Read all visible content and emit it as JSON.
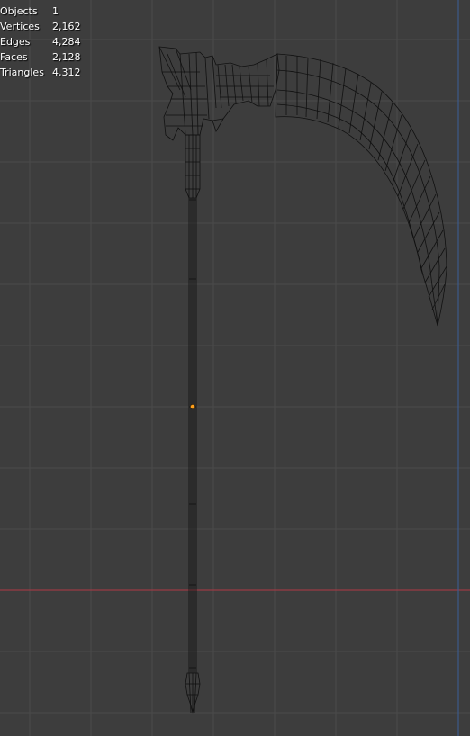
{
  "stats": [
    {
      "label": "Objects",
      "value": "1"
    },
    {
      "label": "Vertices",
      "value": "2,162"
    },
    {
      "label": "Edges",
      "value": "4,284"
    },
    {
      "label": "Faces",
      "value": "2,128"
    },
    {
      "label": "Triangles",
      "value": "4,312"
    }
  ],
  "colors": {
    "background": "#3d3d3d",
    "grid_line": "#4a4a4a",
    "x_axis": "#9a3b44",
    "y_axis": "#3d5b8a",
    "wireframe": "#000000",
    "origin": "#ff9f1c"
  }
}
